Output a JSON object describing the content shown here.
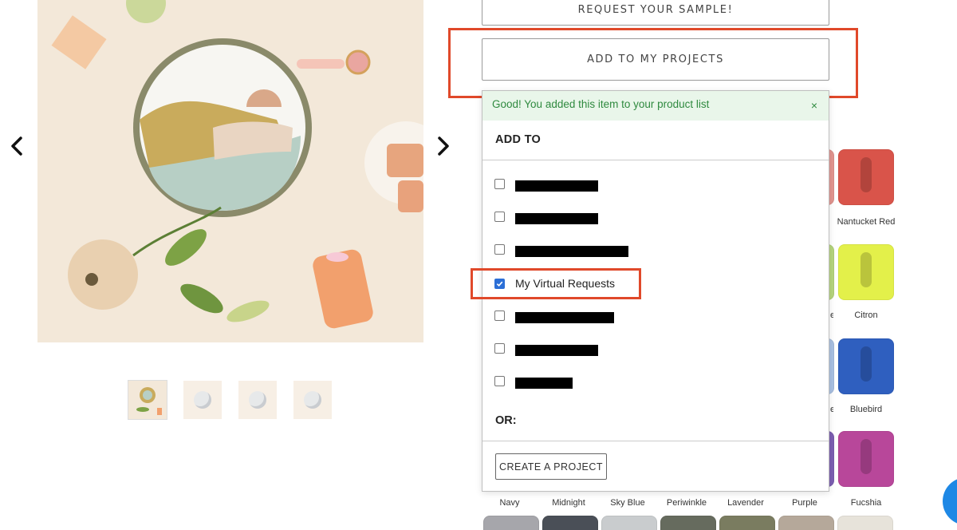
{
  "gallery": {
    "prev_icon": "chevron-left-icon",
    "next_icon": "chevron-right-icon",
    "thumbnail_count": 4
  },
  "actions": {
    "request_sample_label": "REQUEST YOUR SAMPLE!",
    "add_to_projects_label": "ADD TO MY PROJECTS"
  },
  "popup": {
    "alert_text": "Good! You added this item to your product list",
    "alert_close": "×",
    "add_to_heading": "ADD TO",
    "options": [
      {
        "label": "",
        "checked": false,
        "redacted": true
      },
      {
        "label": "",
        "checked": false,
        "redacted": true
      },
      {
        "label": "",
        "checked": false,
        "redacted": true
      },
      {
        "label": "My Virtual Requests",
        "checked": true,
        "redacted": false
      },
      {
        "label": "",
        "checked": false,
        "redacted": true
      },
      {
        "label": "",
        "checked": false,
        "redacted": true
      },
      {
        "label": "",
        "checked": false,
        "redacted": true
      }
    ],
    "or_heading": "OR:",
    "create_project_label": "CREATE A PROJECT"
  },
  "swatches": {
    "right_column": [
      {
        "name": "Nantucket Red",
        "color": "#d9544a"
      },
      {
        "name": "Citron",
        "color": "#e3f04a"
      },
      {
        "name": "Bluebird",
        "color": "#2f5fbf"
      },
      {
        "name": "Fucshia",
        "color": "#b8479a"
      }
    ],
    "partial_column_colors": [
      "#e39590",
      "#b6d67e",
      "#a9c1e3",
      "#7d5fb3"
    ],
    "partial_labels": [
      "e",
      "e"
    ],
    "bottom_row_labels": [
      "Navy",
      "Midnight",
      "Sky Blue",
      "Periwinkle",
      "Lavender",
      "Purple",
      "Fucshia"
    ],
    "next_row_colors": [
      "#a6a6ab",
      "#4a4f57",
      "#c9ccce",
      "#666b5e",
      "#7a7c60",
      "#b5a89a",
      "#e7e3da"
    ]
  }
}
